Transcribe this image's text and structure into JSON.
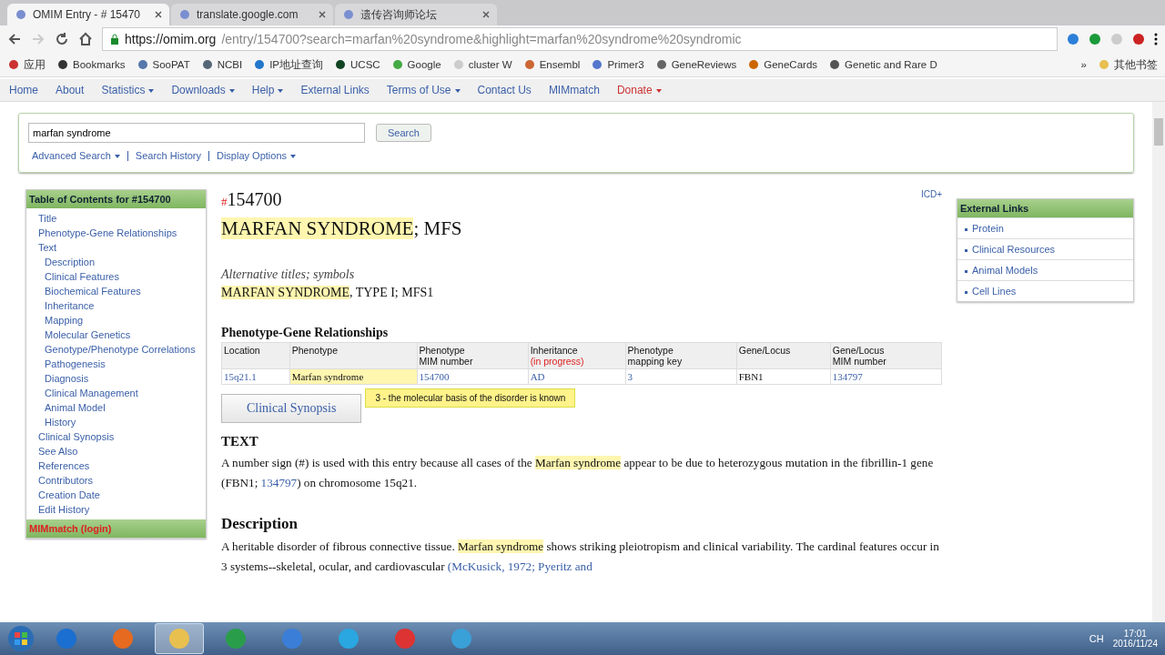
{
  "browser": {
    "tabs": [
      {
        "title": "OMIM Entry - # 15470",
        "selected": true
      },
      {
        "title": "translate.google.com",
        "selected": false
      },
      {
        "title": "遗传咨询师论坛",
        "selected": false
      }
    ],
    "address": {
      "host": "https://omim.org",
      "path": "/entry/154700?search=marfan%20syndrome&highlight=marfan%20syndrome%20syndromic"
    },
    "bookmarks": [
      "应用",
      "Bookmarks",
      "SooPAT",
      "NCBI",
      "IP地址查询",
      "UCSC",
      "Google",
      "cluster W",
      "Ensembl",
      "Primer3",
      "GeneReviews",
      "GeneCards",
      "Genetic and Rare D"
    ],
    "more_bookmarks": "»",
    "other_bookmarks": "其他书签"
  },
  "nav": [
    {
      "label": "Home",
      "dropdown": false,
      "alert": false
    },
    {
      "label": "About",
      "dropdown": false,
      "alert": false
    },
    {
      "label": "Statistics",
      "dropdown": true,
      "alert": false
    },
    {
      "label": "Downloads",
      "dropdown": true,
      "alert": false
    },
    {
      "label": "Help",
      "dropdown": true,
      "alert": false
    },
    {
      "label": "External Links",
      "dropdown": false,
      "alert": false
    },
    {
      "label": "Terms of Use",
      "dropdown": true,
      "alert": false
    },
    {
      "label": "Contact Us",
      "dropdown": false,
      "alert": false
    },
    {
      "label": "MIMmatch",
      "dropdown": false,
      "alert": false
    },
    {
      "label": "Donate",
      "dropdown": true,
      "alert": true
    }
  ],
  "search": {
    "value": "marfan syndrome",
    "button": "Search",
    "links": [
      {
        "label": "Advanced Search",
        "dropdown": true
      },
      {
        "label": "Search History",
        "dropdown": false
      },
      {
        "label": "Display Options",
        "dropdown": true
      }
    ]
  },
  "toc": {
    "title": "Table of Contents for #154700",
    "items": [
      {
        "label": "Title"
      },
      {
        "label": "Phenotype-Gene Relationships"
      },
      {
        "label": "Text",
        "children": [
          {
            "label": "Description"
          },
          {
            "label": "Clinical Features"
          },
          {
            "label": "Biochemical Features"
          },
          {
            "label": "Inheritance"
          },
          {
            "label": "Mapping"
          },
          {
            "label": "Molecular Genetics"
          },
          {
            "label": "Genotype/Phenotype Correlations"
          },
          {
            "label": "Pathogenesis"
          },
          {
            "label": "Diagnosis"
          },
          {
            "label": "Clinical Management"
          },
          {
            "label": "Animal Model"
          },
          {
            "label": "History"
          }
        ]
      },
      {
        "label": "Clinical Synopsis"
      },
      {
        "label": "See Also"
      },
      {
        "label": "References"
      },
      {
        "label": "Contributors"
      },
      {
        "label": "Creation Date"
      },
      {
        "label": "Edit History"
      }
    ],
    "footer": "MIMmatch (login)"
  },
  "entry": {
    "mark": "#",
    "number": "154700",
    "icd": "ICD+",
    "title": [
      {
        "kind": "highlight",
        "text": "MARFAN SYNDROME"
      },
      {
        "kind": "plain",
        "text": "; MFS"
      }
    ],
    "alt_label": "Alternative titles; symbols",
    "alt_title": [
      {
        "kind": "highlight",
        "text": "MARFAN SYNDROME"
      },
      {
        "kind": "plain",
        "text": ", TYPE I; MFS1"
      }
    ],
    "pgr_title": "Phenotype-Gene Relationships",
    "columns": [
      {
        "label": "Location"
      },
      {
        "label": "Phenotype"
      },
      {
        "label": "Phenotype MIM number"
      },
      {
        "label": "Inheritance",
        "note": "(in progress)"
      },
      {
        "label": "Phenotype mapping key"
      },
      {
        "label": "Gene/Locus"
      },
      {
        "label": "Gene/Locus MIM number"
      }
    ],
    "row": [
      {
        "kind": "link",
        "text": "15q21.1"
      },
      {
        "kind": "highlight",
        "text": "Marfan syndrome"
      },
      {
        "kind": "link",
        "text": "154700"
      },
      {
        "kind": "link",
        "text": "AD"
      },
      {
        "kind": "link",
        "text": "3"
      },
      {
        "kind": "plain",
        "text": "FBN1"
      },
      {
        "kind": "link",
        "text": "134797"
      }
    ],
    "tooltip": "3 - the molecular basis of the disorder is known",
    "synopsis_button": "Clinical Synopsis",
    "sections": [
      {
        "heading": "TEXT",
        "kind": "caps",
        "text": [
          {
            "kind": "plain",
            "text": "A number sign (#) is used with this entry because all cases of the "
          },
          {
            "kind": "highlight",
            "text": "Marfan syndrome"
          },
          {
            "kind": "plain",
            "text": " appear to be due to heterozygous mutation in the fibrillin-1 gene (FBN1; "
          },
          {
            "kind": "link",
            "text": "134797"
          },
          {
            "kind": "plain",
            "text": ") on chromosome 15q21."
          }
        ]
      },
      {
        "heading": "Description",
        "kind": "title",
        "text": [
          {
            "kind": "plain",
            "text": "A heritable disorder of fibrous connective tissue. "
          },
          {
            "kind": "highlight",
            "text": "Marfan syndrome"
          },
          {
            "kind": "plain",
            "text": " shows striking pleiotropism and clinical variability. The cardinal features occur in 3 systems--skeletal, ocular, and cardiovascular "
          },
          {
            "kind": "link",
            "text": "(McKusick, 1972; Pyeritz and"
          }
        ]
      }
    ]
  },
  "external_links": {
    "title": "External Links",
    "items": [
      "Protein",
      "Clinical Resources",
      "Animal Models",
      "Cell Lines"
    ]
  },
  "taskbar": {
    "apps": [
      {
        "selected": false
      },
      {
        "selected": false
      },
      {
        "selected": true
      },
      {
        "selected": false
      },
      {
        "selected": false
      },
      {
        "selected": false
      },
      {
        "selected": false
      },
      {
        "selected": false
      }
    ],
    "language": "CH",
    "time": "17:01",
    "date": "2016/11/24"
  }
}
